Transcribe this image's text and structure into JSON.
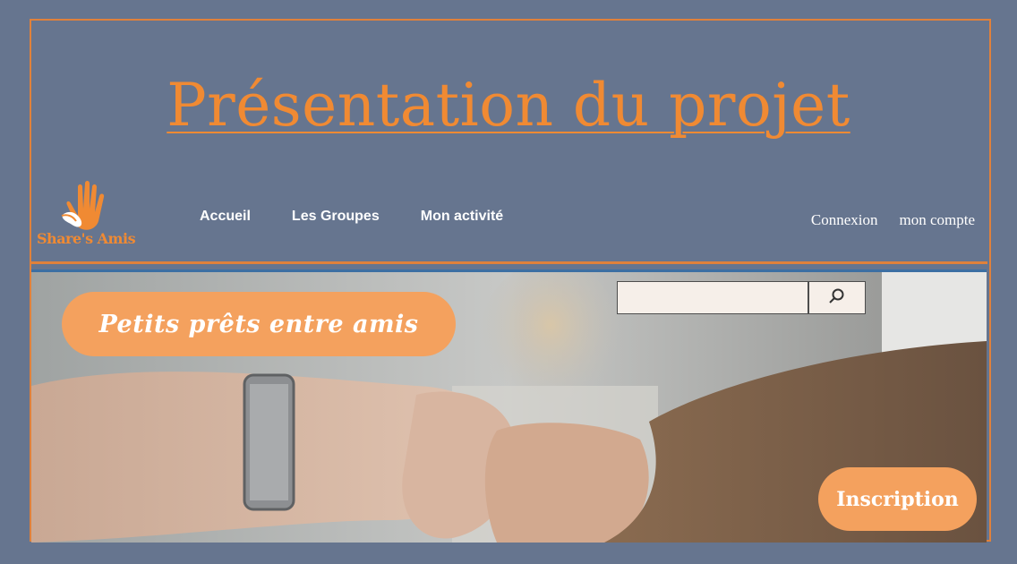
{
  "page_title": "Présentation du projet",
  "logo": {
    "name": "Share's Amis",
    "icon": "hand-logo-icon"
  },
  "nav": {
    "items": [
      "Accueil",
      "Les Groupes",
      "Mon activité"
    ]
  },
  "account": {
    "login": "Connexion",
    "account": "mon compte"
  },
  "hero": {
    "tagline": "Petits prêts entre amis",
    "search": {
      "value": "",
      "icon": "search-icon"
    },
    "signup": "Inscription",
    "image": "fist-bump-photo"
  },
  "colors": {
    "background": "#66758f",
    "accent": "#f08a33",
    "pill": "#f4a15e",
    "search_bg": "#f6efe9"
  }
}
